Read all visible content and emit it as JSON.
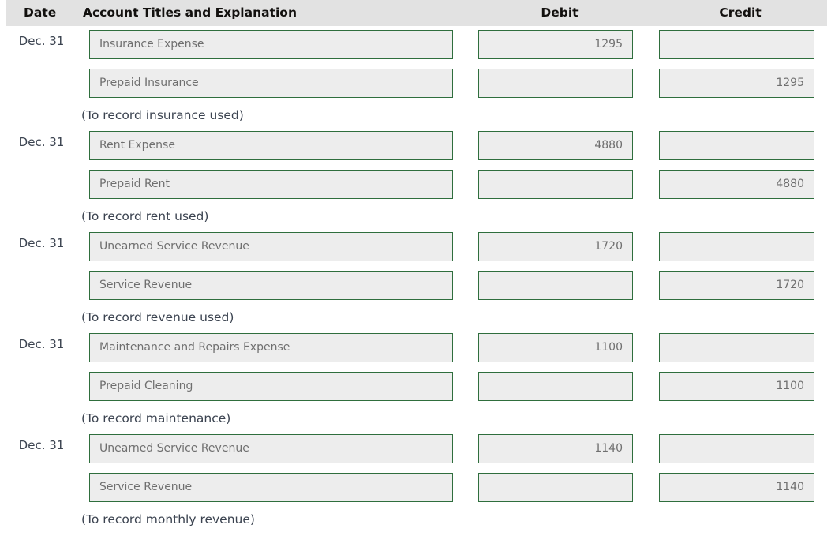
{
  "table": {
    "columns": {
      "date": "Date",
      "account": "Account Titles and Explanation",
      "debit": "Debit",
      "credit": "Credit"
    },
    "entries": [
      {
        "date": "Dec. 31",
        "debit_line": {
          "account": "Insurance Expense",
          "debit": "1295",
          "credit": ""
        },
        "credit_line": {
          "account": "Prepaid Insurance",
          "debit": "",
          "credit": "1295"
        },
        "memo": "(To record insurance used)"
      },
      {
        "date": "Dec. 31",
        "debit_line": {
          "account": "Rent Expense",
          "debit": "4880",
          "credit": ""
        },
        "credit_line": {
          "account": "Prepaid Rent",
          "debit": "",
          "credit": "4880"
        },
        "memo": "(To record rent used)"
      },
      {
        "date": "Dec. 31",
        "debit_line": {
          "account": "Unearned Service Revenue",
          "debit": "1720",
          "credit": ""
        },
        "credit_line": {
          "account": "Service Revenue",
          "debit": "",
          "credit": "1720"
        },
        "memo": "(To record revenue used)"
      },
      {
        "date": "Dec. 31",
        "debit_line": {
          "account": "Maintenance and Repairs Expense",
          "debit": "1100",
          "credit": ""
        },
        "credit_line": {
          "account": "Prepaid Cleaning",
          "debit": "",
          "credit": "1100"
        },
        "memo": "(To record maintenance)"
      },
      {
        "date": "Dec. 31",
        "debit_line": {
          "account": "Unearned Service Revenue",
          "debit": "1140",
          "credit": ""
        },
        "credit_line": {
          "account": "Service Revenue",
          "debit": "",
          "credit": "1140"
        },
        "memo": "(To record monthly revenue)"
      }
    ]
  },
  "colors": {
    "header_background": "#e2e2e2",
    "field_border": "#2f6e3d",
    "field_background": "#ededed",
    "field_text": "#6f6f6f",
    "body_text": "#3b4350"
  }
}
